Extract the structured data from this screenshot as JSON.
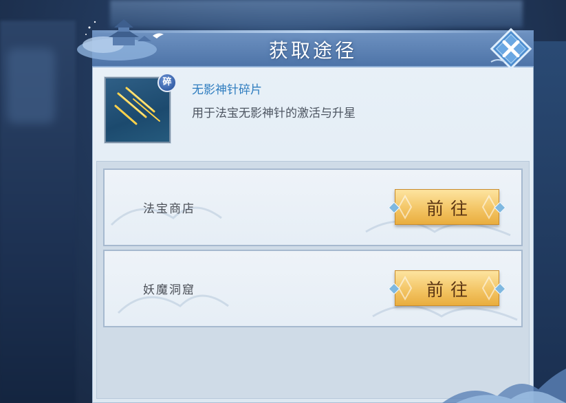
{
  "dialog": {
    "title": "获取途径"
  },
  "item": {
    "badge": "碎",
    "name": "无影神针碎片",
    "description": "用于法宝无影神针的激活与升星",
    "icon": "golden-needles-icon"
  },
  "sources": [
    {
      "label": "法宝商店",
      "button_label": "前往"
    },
    {
      "label": "妖魔洞窟",
      "button_label": "前往"
    }
  ],
  "colors": {
    "title_bar": "#5a80b4",
    "item_name": "#2f7dbf",
    "button_gold": "#f3c565",
    "button_text": "#5b3513"
  }
}
